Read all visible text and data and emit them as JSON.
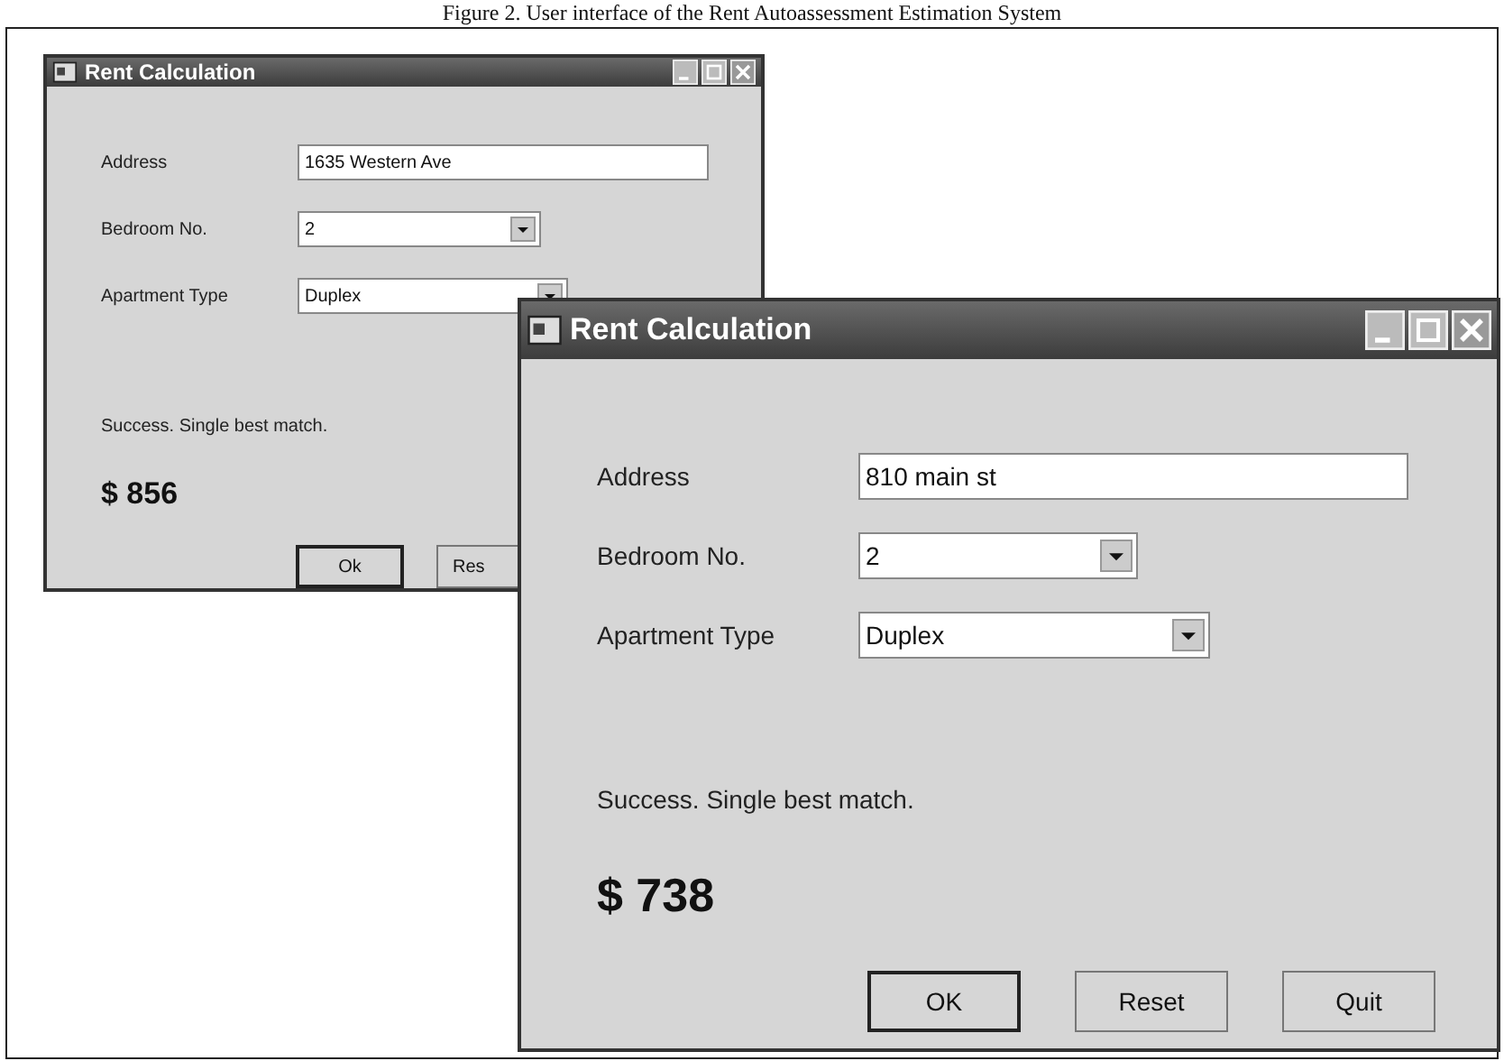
{
  "caption": "Figure 2. User interface of the Rent Autoassessment Estimation System",
  "windows": [
    {
      "title": "Rent Calculation",
      "fields": [
        {
          "label": "Address",
          "kind": "text",
          "value": "1635 Western Ave"
        },
        {
          "label": "Bedroom No.",
          "kind": "combo",
          "value": "2"
        },
        {
          "label": "Apartment Type",
          "kind": "combo",
          "value": "Duplex"
        }
      ],
      "status": "Success. Single best match.",
      "price": "$ 856",
      "buttons": [
        {
          "label": "Ok",
          "default": true
        },
        {
          "label": "Res",
          "default": false
        }
      ]
    },
    {
      "title": "Rent Calculation",
      "fields": [
        {
          "label": "Address",
          "kind": "text",
          "value": "810 main st"
        },
        {
          "label": "Bedroom No.",
          "kind": "combo",
          "value": "2"
        },
        {
          "label": "Apartment Type",
          "kind": "combo",
          "value": "Duplex"
        }
      ],
      "status": "Success. Single best match.",
      "price": "$ 738",
      "buttons": [
        {
          "label": "OK",
          "default": true
        },
        {
          "label": "Reset",
          "default": false
        },
        {
          "label": "Quit",
          "default": false
        }
      ]
    }
  ]
}
